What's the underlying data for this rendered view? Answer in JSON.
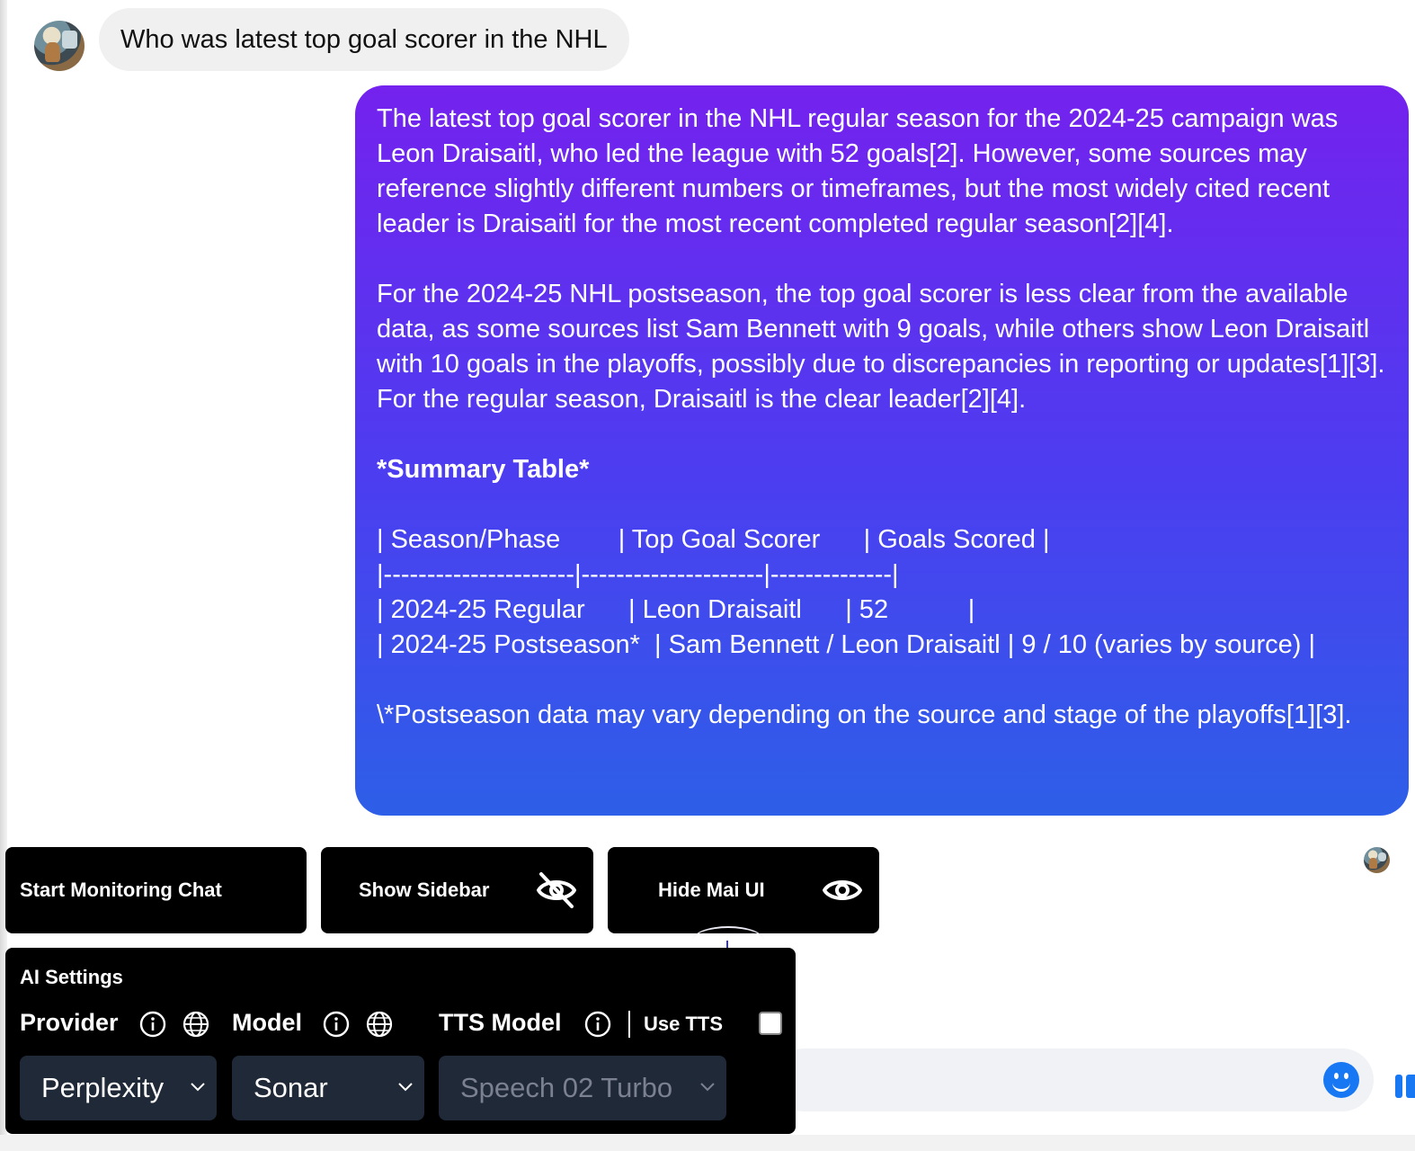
{
  "chat": {
    "user_question": "Who was latest top goal scorer in the NHL",
    "ai_answer": {
      "p1": "The latest top goal scorer in the NHL regular season for the 2024-25 campaign was Leon Draisaitl, who led the league with 52 goals[2]. However, some sources may reference slightly different numbers or timeframes, but the most widely cited recent leader is Draisaitl for the most recent completed regular season[2][4].",
      "p2": "For the 2024-25 NHL postseason, the top goal scorer is less clear from the available data, as some sources list Sam Bennett with 9 goals, while others show Leon Draisaitl with 10 goals in the playoffs, possibly due to discrepancies in reporting or updates[1][3]. For the regular season, Draisaitl is the clear leader[2][4].",
      "summary_heading": "*Summary Table*",
      "table_lines": [
        "| Season/Phase        | Top Goal Scorer      | Goals Scored |",
        "|----------------------|---------------------|--------------|",
        "| 2024-25 Regular      | Leon Draisaitl      | 52           |",
        "| 2024-25 Postseason*  | Sam Bennett / Leon Draisaitl | 9 / 10 (varies by source) |"
      ],
      "footnote": "\\*Postseason data may vary depending on the source and stage of the playoffs[1][3]."
    }
  },
  "toolbar": {
    "start_monitoring_label": "Start Monitoring Chat",
    "show_sidebar_label": "Show Sidebar",
    "hide_ui_label": "Hide Mai UI"
  },
  "ai_settings": {
    "title": "AI Settings",
    "provider_label": "Provider",
    "model_label": "Model",
    "tts_model_label": "TTS Model",
    "use_tts_label": "Use TTS",
    "use_tts_checked": false,
    "provider_value": "Perplexity",
    "model_value": "Sonar",
    "tts_model_value": "Speech 02 Turbo"
  },
  "icons": {
    "info": "info-circle-icon",
    "globe": "globe-icon",
    "eye": "eye-icon",
    "eye_off": "eye-off-icon",
    "chevron": "chevron-down-icon",
    "emoji": "emoji-icon"
  },
  "colors": {
    "bubble_gradient_top": "#7422ee",
    "bubble_gradient_bottom": "#2d5fe8",
    "accent_blue": "#1877f2",
    "panel_bg": "#000000",
    "select_bg": "#1f2937"
  }
}
